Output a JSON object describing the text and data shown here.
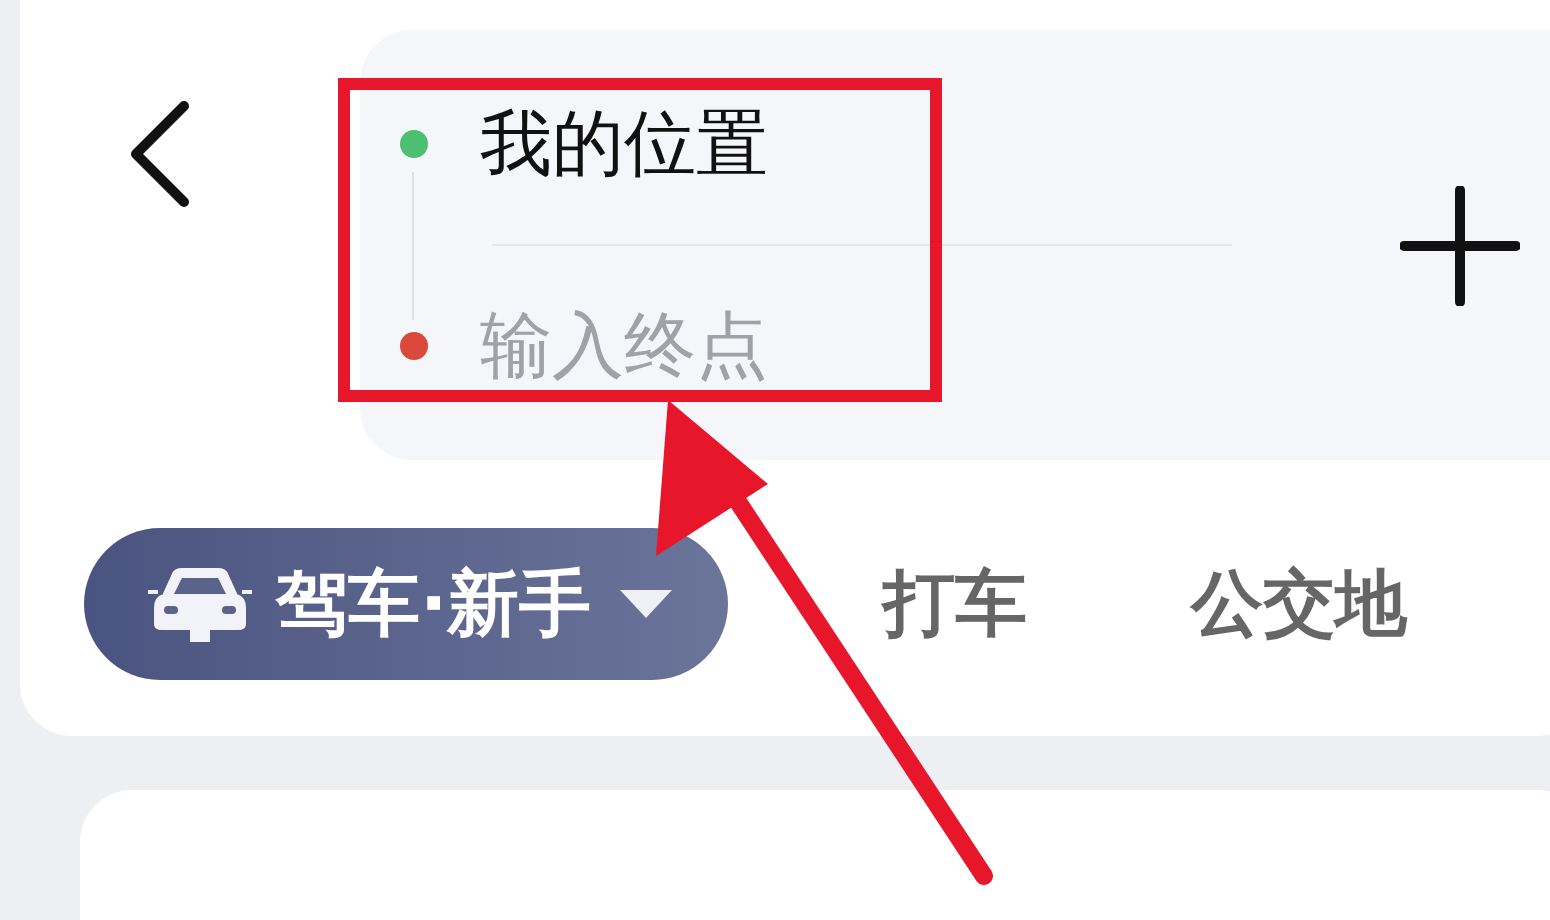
{
  "route": {
    "origin": "我的位置",
    "destination_placeholder": "输入终点"
  },
  "modes": [
    {
      "label": "驾车·新手",
      "selected": true
    },
    {
      "label": "打车",
      "selected": false
    },
    {
      "label": "公交地",
      "selected": false
    }
  ]
}
